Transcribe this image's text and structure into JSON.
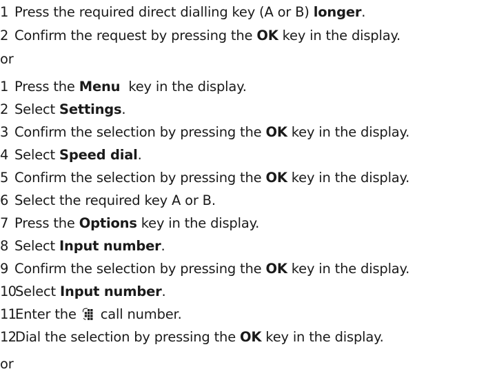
{
  "steps_block_1": [
    {
      "n": "1",
      "pre": "Press the required direct dialling key (A or B) ",
      "bold": "longer",
      "post": "."
    },
    {
      "n": "2",
      "pre": "Confirm the request by pressing the ",
      "bold": "OK",
      "post": " key in the display."
    }
  ],
  "or_1": "or",
  "steps_block_2": [
    {
      "n": "1",
      "pre": "Press the ",
      "bold": "Menu",
      "post": "  key in the display."
    },
    {
      "n": "2",
      "pre": "Select ",
      "bold": "Settings",
      "post": "."
    },
    {
      "n": "3",
      "pre": "Confirm the selection by pressing the ",
      "bold": "OK",
      "post": " key in the display."
    },
    {
      "n": "4",
      "pre": "Select ",
      "bold": "Speed dial",
      "post": "."
    },
    {
      "n": "5",
      "pre": "Confirm the selection by pressing the ",
      "bold": "OK",
      "post": " key in the display."
    },
    {
      "n": "6",
      "pre": "Select the required key A or B.",
      "bold": "",
      "post": ""
    },
    {
      "n": "7",
      "pre": "Press the ",
      "bold": "Options",
      "post": " key in the display."
    },
    {
      "n": "8",
      "pre": "Select ",
      "bold": "Input number",
      "post": "."
    },
    {
      "n": "9",
      "pre": "Confirm the selection by pressing the ",
      "bold": "OK",
      "post": " key in the display."
    },
    {
      "n": "10",
      "pre": "Select ",
      "bold": "Input number",
      "post": "."
    },
    {
      "n": "11",
      "pre": "Enter the ",
      "icon": "keypad-icon",
      "post": " call number."
    },
    {
      "n": "12",
      "pre": "Dial the selection by pressing the ",
      "bold": "OK",
      "post": " key in the display."
    }
  ],
  "or_2": "or"
}
